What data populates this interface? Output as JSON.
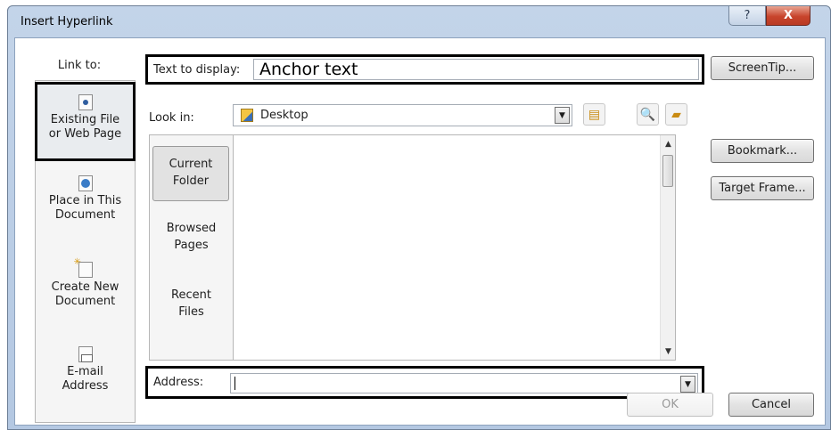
{
  "dialog": {
    "title": "Insert Hyperlink",
    "help_glyph": "?",
    "close_glyph": "X"
  },
  "link_to": {
    "label": "Link to:",
    "items": [
      {
        "line1": "Existing File",
        "line2": "or Web Page",
        "icon": "file-icon",
        "selected": true
      },
      {
        "line1": "Place in This",
        "line2": "Document",
        "icon": "document-place-icon"
      },
      {
        "line1": "Create New",
        "line2": "Document",
        "icon": "new-document-icon"
      },
      {
        "line1": "E-mail",
        "line2": "Address",
        "icon": "email-icon"
      }
    ]
  },
  "text_to_display": {
    "label": "Text to display:",
    "value": "Anchor text"
  },
  "look_in": {
    "label": "Look in:",
    "value": "Desktop"
  },
  "places": [
    {
      "line1": "Current",
      "line2": "Folder",
      "selected": true
    },
    {
      "line1": "Browsed",
      "line2": "Pages"
    },
    {
      "line1": "Recent",
      "line2": "Files"
    }
  ],
  "address": {
    "label": "Address:",
    "value": ""
  },
  "buttons": {
    "screentip": "ScreenTip...",
    "bookmark": "Bookmark...",
    "target_frame": "Target Frame...",
    "ok": "OK",
    "cancel": "Cancel"
  }
}
